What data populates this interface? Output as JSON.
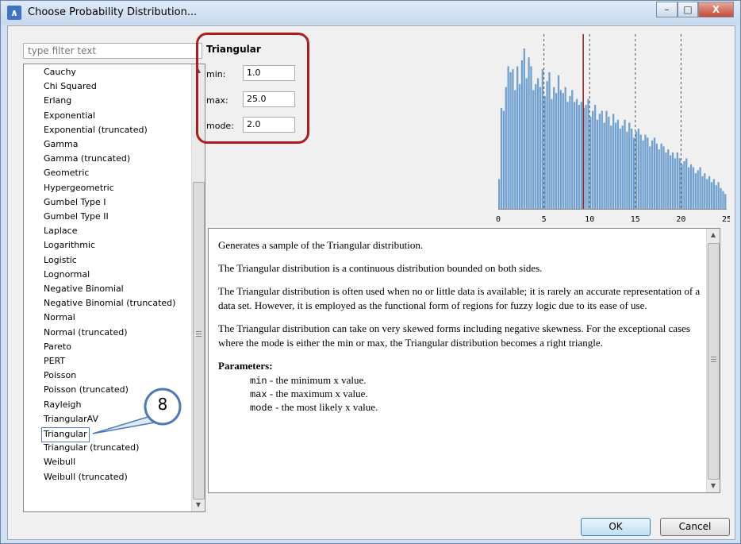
{
  "window": {
    "title": "Choose Probability Distribution...",
    "app_icon_glyph": "∧"
  },
  "window_controls": {
    "minimize": "–",
    "maximize": "□",
    "close": "X"
  },
  "filter": {
    "placeholder": "type filter text"
  },
  "distributions": [
    "Cauchy",
    "Chi Squared",
    "Erlang",
    "Exponential",
    "Exponential (truncated)",
    "Gamma",
    "Gamma (truncated)",
    "Geometric",
    "Hypergeometric",
    "Gumbel Type I",
    "Gumbel Type II",
    "Laplace",
    "Logarithmic",
    "Logistic",
    "Lognormal",
    "Negative Binomial",
    "Negative Binomial (truncated)",
    "Normal",
    "Normal (truncated)",
    "Pareto",
    "PERT",
    "Poisson",
    "Poisson (truncated)",
    "Rayleigh",
    "TriangularAV",
    "Triangular",
    "Triangular (truncated)",
    "Weibull",
    "Weibull (truncated)"
  ],
  "selected_distribution": "Triangular",
  "parameters": {
    "title": "Triangular",
    "min_label": "min:",
    "min_value": "1.0",
    "max_label": "max:",
    "max_value": "25.0",
    "mode_label": "mode:",
    "mode_value": "2.0"
  },
  "callout": {
    "number": "8"
  },
  "chart_data": {
    "type": "bar",
    "title": "",
    "xlabel": "",
    "ylabel": "",
    "x_ticks": [
      "0",
      "5",
      "10",
      "15",
      "20",
      "25"
    ],
    "xlim": [
      0,
      25
    ],
    "mean_marker": 9.3,
    "dashed_lines": [
      5,
      10,
      15,
      20
    ],
    "bar_color": "#6fa0cf",
    "marker_color": "#8b1a1a",
    "bin_width": 0.25,
    "values": [
      20,
      68,
      66,
      82,
      96,
      92,
      94,
      80,
      96,
      84,
      100,
      108,
      88,
      102,
      96,
      80,
      84,
      88,
      82,
      94,
      76,
      86,
      92,
      74,
      82,
      78,
      90,
      80,
      78,
      82,
      72,
      76,
      80,
      72,
      74,
      70,
      72,
      68,
      70,
      74,
      62,
      66,
      70,
      60,
      64,
      66,
      58,
      66,
      62,
      56,
      64,
      58,
      60,
      54,
      56,
      60,
      52,
      58,
      54,
      48,
      52,
      54,
      50,
      46,
      50,
      48,
      42,
      46,
      48,
      44,
      40,
      44,
      42,
      38,
      40,
      36,
      38,
      34,
      38,
      34,
      30,
      32,
      34,
      28,
      30,
      28,
      24,
      26,
      28,
      22,
      24,
      20,
      22,
      18,
      20,
      16,
      18,
      14,
      12,
      10
    ]
  },
  "description": {
    "p1": "Generates a sample of the Triangular distribution.",
    "p2": "The Triangular distribution is a continuous distribution bounded on both sides.",
    "p3": "The Triangular distribution is often used when no or little data is available; it is rarely an accurate representation of a data set. However, it is employed as the functional form of regions for fuzzy logic due to its ease of use.",
    "p4": "The Triangular distribution can take on very skewed forms including negative skewness. For the exceptional cases where the mode is either the min or max, the Triangular distribution becomes a right triangle.",
    "params_heading": "Parameters:",
    "param_min_name": "min",
    "param_min_desc": " - the minimum x value.",
    "param_max_name": "max",
    "param_max_desc": " - the maximum x value.",
    "param_mode_name": "mode",
    "param_mode_desc": " - the most likely x value."
  },
  "buttons": {
    "ok": "OK",
    "cancel": "Cancel"
  },
  "colors": {
    "accent": "#b01c1c",
    "selection_border": "#4d7bbd"
  }
}
